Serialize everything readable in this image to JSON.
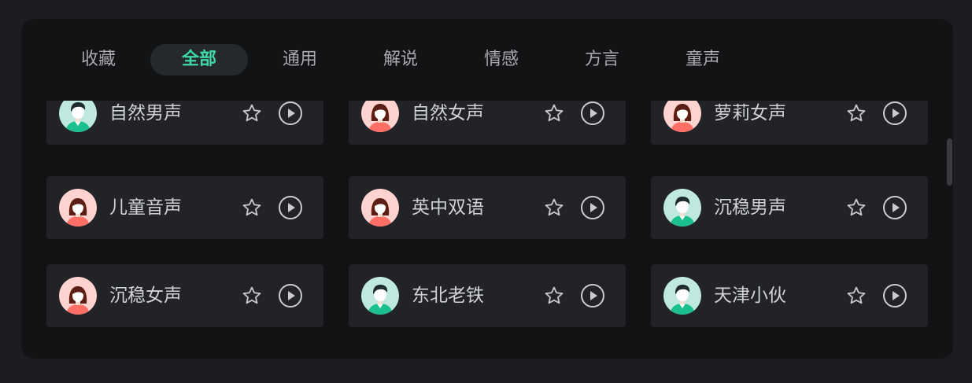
{
  "tabs": [
    {
      "label": "收藏",
      "active": false
    },
    {
      "label": "全部",
      "active": true
    },
    {
      "label": "通用",
      "active": false
    },
    {
      "label": "解说",
      "active": false
    },
    {
      "label": "情感",
      "active": false
    },
    {
      "label": "方言",
      "active": false
    },
    {
      "label": "童声",
      "active": false
    }
  ],
  "voices": [
    {
      "label": "自然男声",
      "avatar": "male-avatar-icon"
    },
    {
      "label": "自然女声",
      "avatar": "female-avatar-icon"
    },
    {
      "label": "萝莉女声",
      "avatar": "female-avatar-icon"
    },
    {
      "label": "儿童音声",
      "avatar": "female-avatar-icon"
    },
    {
      "label": "英中双语",
      "avatar": "female-avatar-icon"
    },
    {
      "label": "沉稳男声",
      "avatar": "male-avatar-icon"
    },
    {
      "label": "沉稳女声",
      "avatar": "female-avatar-icon"
    },
    {
      "label": "东北老铁",
      "avatar": "male-avatar-icon"
    },
    {
      "label": "天津小伙",
      "avatar": "male-avatar-icon"
    }
  ],
  "icons": {
    "favorite": "star-icon",
    "preview": "play-icon"
  },
  "colors": {
    "accent": "#3fd8a8",
    "panel": "#121315",
    "card": "#212327",
    "male_avatar_bg": "#bfe9df",
    "female_avatar_bg": "#ffd3d0"
  }
}
